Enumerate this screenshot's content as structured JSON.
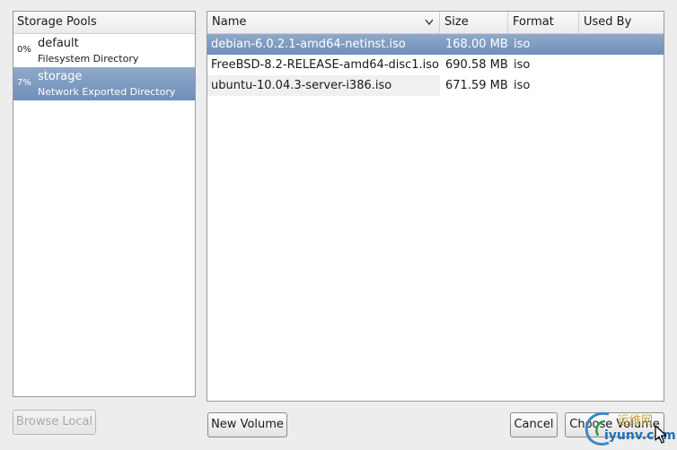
{
  "pools": {
    "header": "Storage Pools",
    "items": [
      {
        "usage": "0%",
        "name": "default",
        "type": "Filesystem Directory",
        "selected": false
      },
      {
        "usage": "7%",
        "name": "storage",
        "type": "Network Exported Directory",
        "selected": true
      }
    ]
  },
  "volumes": {
    "columns": {
      "name": "Name",
      "size": "Size",
      "format": "Format",
      "used_by": "Used By"
    },
    "rows": [
      {
        "name": "debian-6.0.2.1-amd64-netinst.iso",
        "size": "168.00 MB",
        "format": "iso",
        "used_by": "",
        "selected": true
      },
      {
        "name": "FreeBSD-8.2-RELEASE-amd64-disc1.iso",
        "size": "690.58 MB",
        "format": "iso",
        "used_by": "",
        "selected": false
      },
      {
        "name": "ubuntu-10.04.3-server-i386.iso",
        "size": "671.59 MB",
        "format": "iso",
        "used_by": "",
        "selected": false
      }
    ]
  },
  "buttons": {
    "browse_local": "Browse Local",
    "new_volume": "New Volume",
    "cancel": "Cancel",
    "choose_volume": "Choose Volume"
  },
  "watermark": {
    "line1": "运维网",
    "line2": "iyunv.com"
  },
  "icons": {
    "sort": "sort-descending-icon",
    "cursor": "mouse-pointer-icon"
  },
  "colors": {
    "selection": "#7b98c0",
    "window_bg": "#ededed"
  }
}
